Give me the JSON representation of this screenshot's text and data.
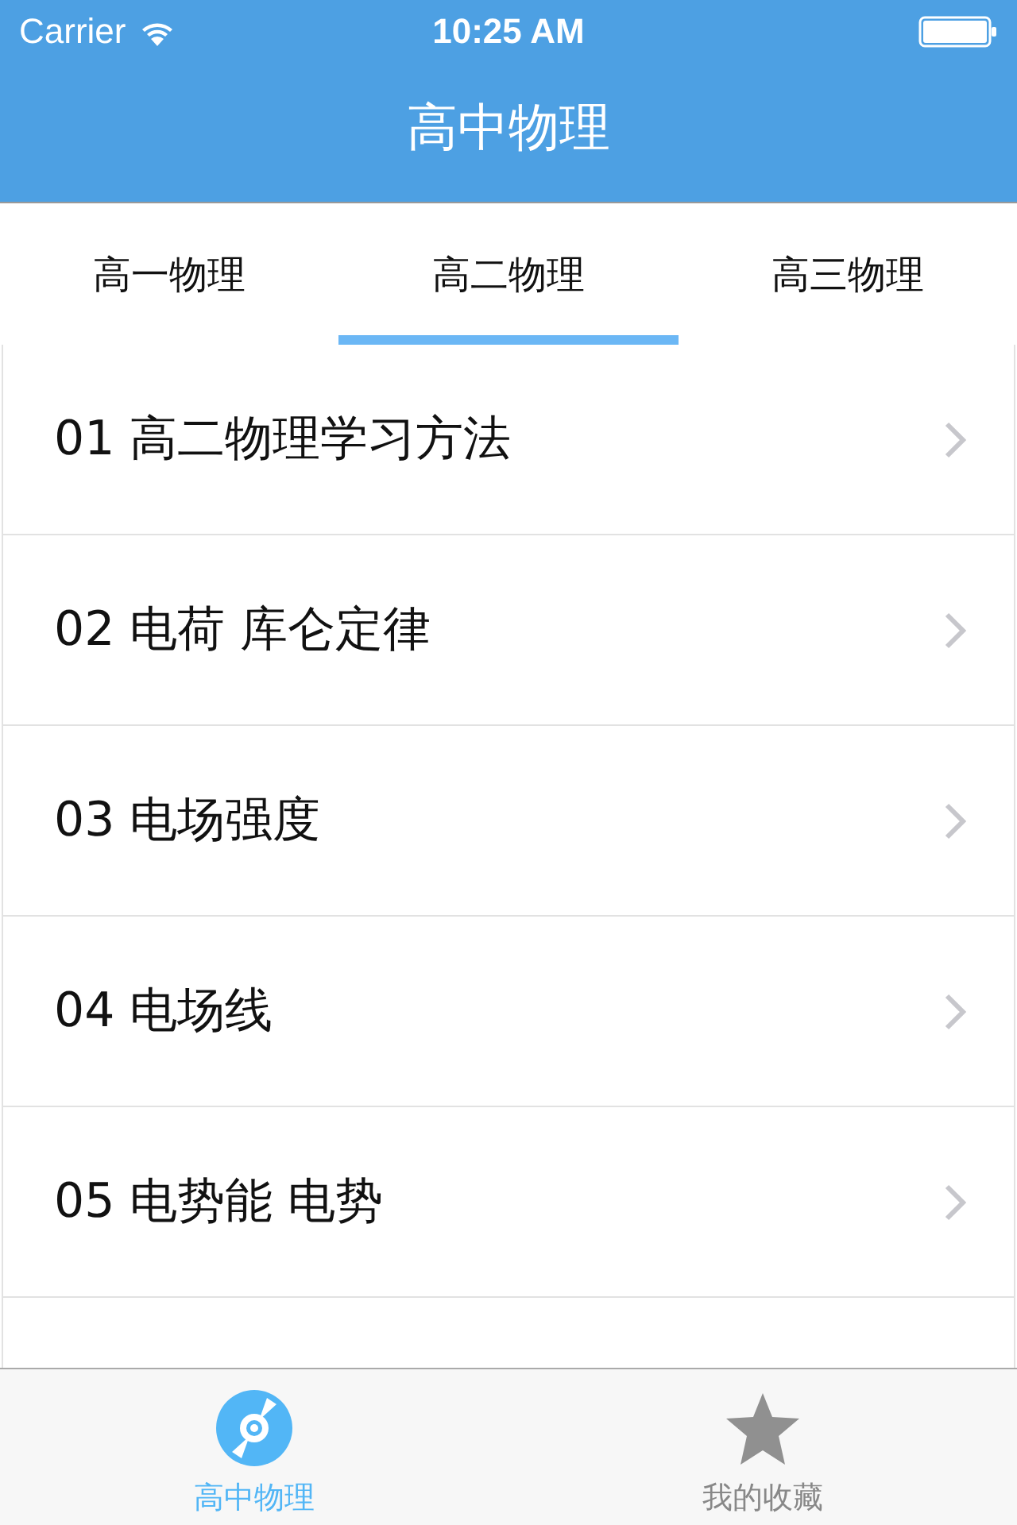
{
  "status_bar": {
    "carrier": "Carrier",
    "time": "10:25 AM"
  },
  "nav_bar": {
    "title": "高中物理"
  },
  "tabs": [
    {
      "label": "高一物理",
      "selected": false
    },
    {
      "label": "高二物理",
      "selected": true
    },
    {
      "label": "高三物理",
      "selected": false
    }
  ],
  "lessons": [
    {
      "title": "01 高二物理学习方法"
    },
    {
      "title": "02 电荷 库仑定律"
    },
    {
      "title": "03 电场强度"
    },
    {
      "title": "04 电场线"
    },
    {
      "title": "05 电势能 电势"
    }
  ],
  "tab_bar": [
    {
      "label": "高中物理",
      "kind": "disc",
      "selected": true
    },
    {
      "label": "我的收藏",
      "kind": "star",
      "selected": false
    }
  ]
}
